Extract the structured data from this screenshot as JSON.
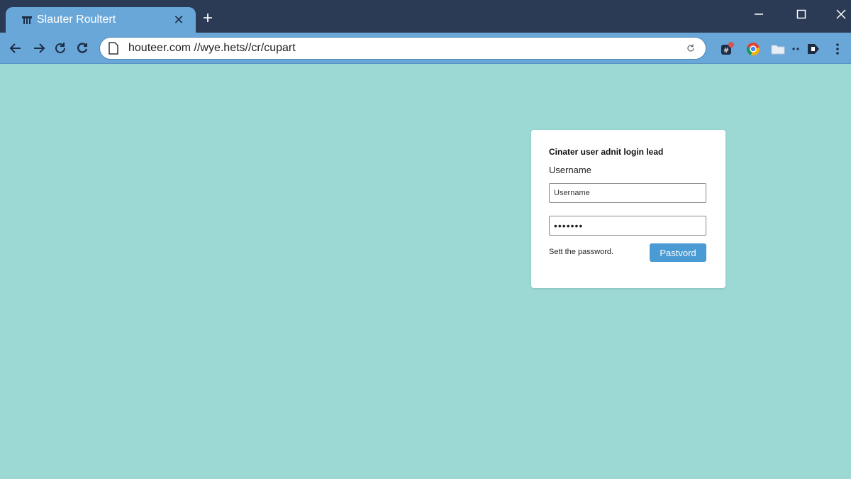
{
  "browser": {
    "tab": {
      "title": "Slauter Roultert",
      "favicon": "router-icon"
    },
    "address_bar": {
      "url": "houteer.com //wye.hets//cr/cupart"
    },
    "extensions": [
      "puzzle-badge-icon",
      "chrome-icon",
      "folder-icon",
      "more-dots-icon",
      "profile-icon",
      "menu-dots-icon"
    ]
  },
  "login": {
    "title": "Cinater user adnit login lead",
    "username_label": "Username",
    "username_placeholder": "Username",
    "password_value": "•••••••",
    "hint": "Sett the password.",
    "submit_label": "Pastvord"
  },
  "colors": {
    "page_background": "#9cd9d4",
    "chrome_dark": "#2b3a55",
    "chrome_light": "#6aa7d9",
    "button": "#4a9ad3"
  }
}
